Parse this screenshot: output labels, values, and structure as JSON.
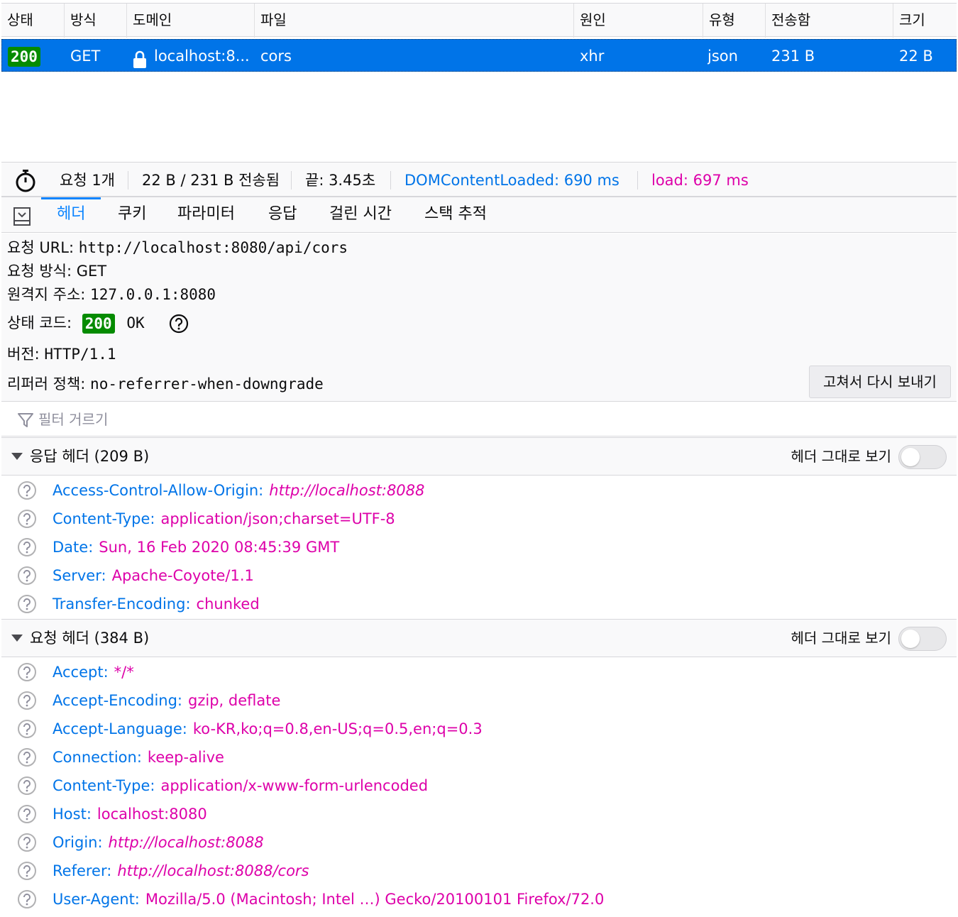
{
  "columns": [
    "상태",
    "방식",
    "도메인",
    "파일",
    "원인",
    "유형",
    "전송함",
    "크기"
  ],
  "request_row": {
    "status": "200",
    "method": "GET",
    "domain": "localhost:8...",
    "file": "cors",
    "cause": "xhr",
    "type": "json",
    "transferred": "231 B",
    "size": "22 B"
  },
  "status_bar": {
    "requests": "요청 1개",
    "transferred": "22 B / 231 B 전송됨",
    "finish": "끝: 3.45초",
    "dom": "DOMContentLoaded: 690 ms",
    "load": "load: 697 ms"
  },
  "tabs": [
    "헤더",
    "쿠키",
    "파라미터",
    "응답",
    "걸린 시간",
    "스택 추적"
  ],
  "summary": {
    "url_label": "요청 URL:",
    "url": "http://localhost:8080/api/cors",
    "method_label": "요청 방식:",
    "method": "GET",
    "remote_label": "원격지 주소:",
    "remote": "127.0.0.1:8080",
    "status_label": "상태 코드:",
    "status_code": "200",
    "status_text": "OK",
    "version_label": "버전:",
    "version": "HTTP/1.1",
    "referrer_label": "리퍼러 정책:",
    "referrer": "no-referrer-when-downgrade",
    "resend": "고쳐서 다시 보내기"
  },
  "filter_placeholder": "필터 거르기",
  "response_headers": {
    "title": "응답 헤더 (209 B)",
    "raw_label": "헤더 그대로 보기",
    "items": [
      {
        "name": "Access-Control-Allow-Origin:",
        "value": "http://localhost:8088"
      },
      {
        "name": "Content-Type:",
        "value": "application/json;charset=UTF-8"
      },
      {
        "name": "Date:",
        "value": "Sun, 16 Feb 2020 08:45:39 GMT"
      },
      {
        "name": "Server:",
        "value": "Apache-Coyote/1.1"
      },
      {
        "name": "Transfer-Encoding:",
        "value": "chunked"
      }
    ]
  },
  "request_headers": {
    "title": "요청 헤더 (384 B)",
    "raw_label": "헤더 그대로 보기",
    "items": [
      {
        "name": "Accept:",
        "value": "*/*"
      },
      {
        "name": "Accept-Encoding:",
        "value": "gzip, deflate"
      },
      {
        "name": "Accept-Language:",
        "value": "ko-KR,ko;q=0.8,en-US;q=0.5,en;q=0.3"
      },
      {
        "name": "Connection:",
        "value": "keep-alive"
      },
      {
        "name": "Content-Type:",
        "value": "application/x-www-form-urlencoded"
      },
      {
        "name": "Host:",
        "value": "localhost:8080"
      },
      {
        "name": "Origin:",
        "value": "http://localhost:8088"
      },
      {
        "name": "Referer:",
        "value": "http://localhost:8088/cors"
      },
      {
        "name": "User-Agent:",
        "value": "Mozilla/5.0 (Macintosh; Intel …) Gecko/20100101 Firefox/72.0"
      }
    ]
  },
  "colors": {
    "accent": "#0a84ff",
    "selected_row": "#0074e8",
    "status_ok": "#058b00",
    "header_name": "#0074e8",
    "header_value": "#dd00a9"
  },
  "icons": {
    "timer": "stopwatch-icon",
    "lock": "lock-icon",
    "panel_toggle": "panel-toggle-icon",
    "filter": "filter-icon",
    "help": "question-icon"
  }
}
